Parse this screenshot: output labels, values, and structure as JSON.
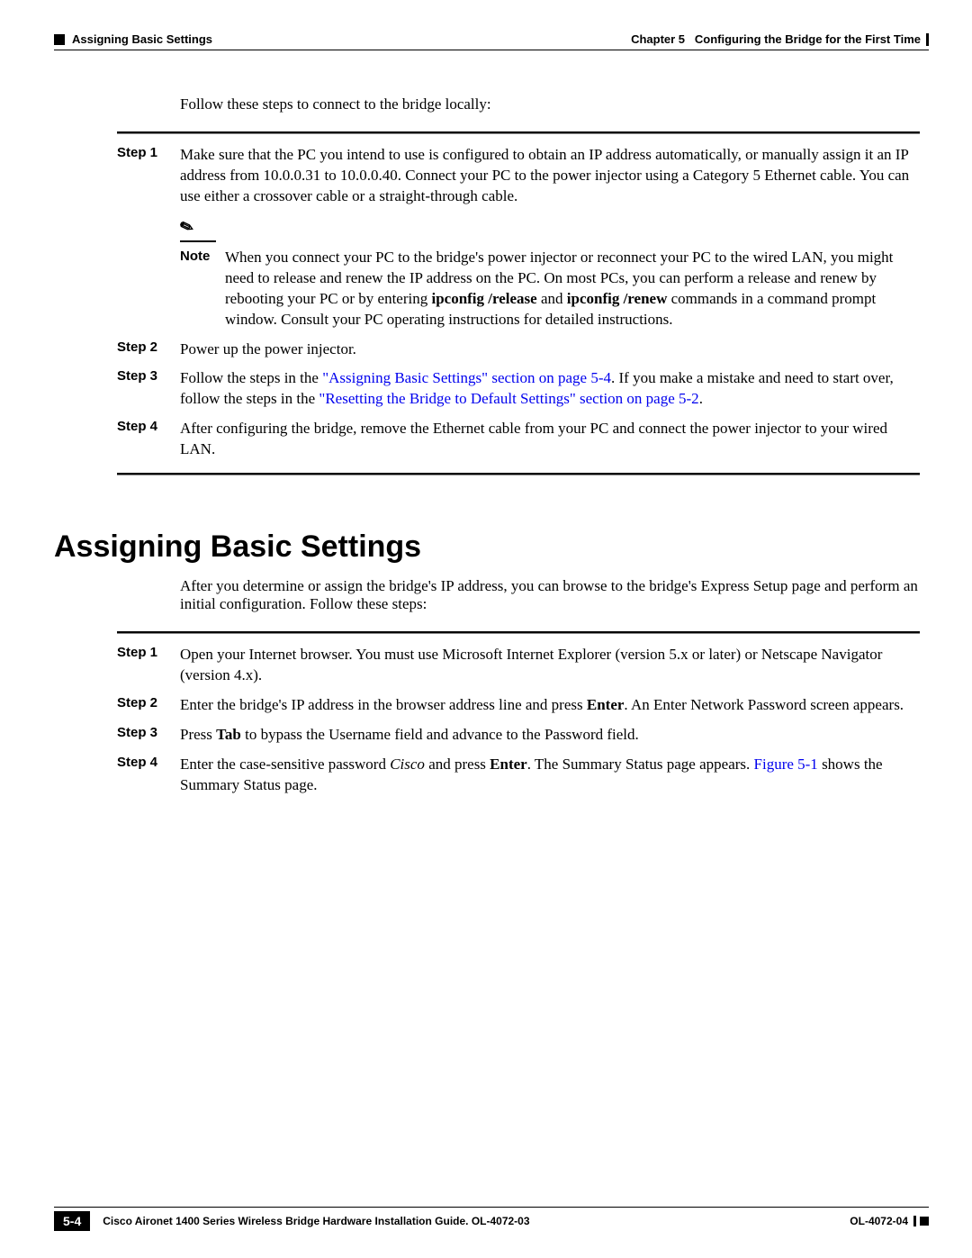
{
  "header": {
    "section": "Assigning Basic Settings",
    "chapter_label": "Chapter 5",
    "chapter_title": "Configuring the Bridge for the First Time"
  },
  "intro1": "Follow these steps to connect to the bridge locally:",
  "steps1": {
    "s1": {
      "label": "Step 1",
      "text": "Make sure that the PC you intend to use is configured to obtain an IP address automatically, or manually assign it an IP address from 10.0.0.31 to 10.0.0.40. Connect your PC to the power injector using a Category 5 Ethernet cable. You can use either a crossover cable or a straight-through cable."
    },
    "note": {
      "label": "Note",
      "t1": "When you connect your PC to the bridge's power injector or reconnect your PC to the wired LAN, you might need to release and renew the IP address on the PC. On most PCs, you can perform a release and renew by rebooting your PC or by entering ",
      "b1": "ipconfig /release",
      "t2": " and ",
      "b2": "ipconfig /renew",
      "t3": " commands in a command prompt window. Consult your PC operating instructions for detailed instructions."
    },
    "s2": {
      "label": "Step 2",
      "text": "Power up the power injector."
    },
    "s3": {
      "label": "Step 3",
      "t1": "Follow the steps in the ",
      "l1": "\"Assigning Basic Settings\" section on page 5-4",
      "t2": ". If you make a mistake and need to start over, follow the steps in the ",
      "l2": "\"Resetting the Bridge to Default Settings\" section on page 5-2",
      "t3": "."
    },
    "s4": {
      "label": "Step 4",
      "text": "After configuring the bridge, remove the Ethernet cable from your PC and connect the power injector to your wired LAN."
    }
  },
  "section_title": "Assigning Basic Settings",
  "intro2": "After you determine or assign the bridge's IP address, you can browse to the bridge's Express Setup page and perform an initial configuration. Follow these steps:",
  "steps2": {
    "s1": {
      "label": "Step 1",
      "text": "Open your Internet browser. You must use Microsoft Internet Explorer (version 5.x or later) or Netscape Navigator (version 4.x)."
    },
    "s2": {
      "label": "Step 2",
      "t1": "Enter the bridge's IP address in the browser address line and press ",
      "b1": "Enter",
      "t2": ". An Enter Network Password screen appears."
    },
    "s3": {
      "label": "Step 3",
      "t1": "Press ",
      "b1": "Tab",
      "t2": " to bypass the Username field and advance to the Password field."
    },
    "s4": {
      "label": "Step 4",
      "t1": "Enter the case-sensitive password ",
      "i1": "Cisco",
      "t2": " and press ",
      "b1": "Enter",
      "t3": ". The Summary Status page appears. ",
      "l1": "Figure 5-1",
      "t4": " shows the Summary Status page."
    }
  },
  "footer": {
    "page": "5-4",
    "title": "Cisco Aironet 1400 Series Wireless Bridge Hardware Installation Guide. OL-4072-03",
    "doc": "OL-4072-04"
  }
}
